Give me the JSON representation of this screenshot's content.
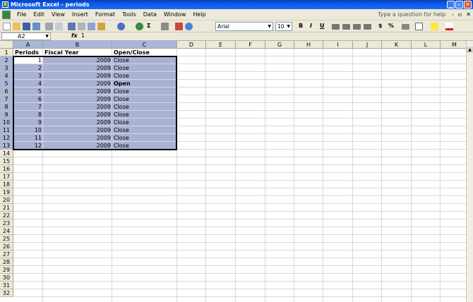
{
  "window": {
    "title": "Microsoft Excel - periods",
    "min": "_",
    "max": "▫",
    "close": "✕"
  },
  "menu": {
    "items": [
      "File",
      "Edit",
      "View",
      "Insert",
      "Format",
      "Tools",
      "Data",
      "Window",
      "Help"
    ],
    "help_placeholder": "Type a question for help",
    "doc_min": "-",
    "doc_restore": "▫",
    "doc_close": "✕"
  },
  "toolbar": {
    "font": "Arial",
    "size": "10",
    "bold": "B",
    "italic": "I",
    "underline": "U",
    "currency": "$",
    "percent": "%",
    "sigma": "Σ"
  },
  "formula": {
    "namebox": "A2",
    "fx": "fx",
    "value": "1"
  },
  "grid": {
    "columns": [
      "A",
      "B",
      "C",
      "D",
      "E",
      "F",
      "G",
      "H",
      "I",
      "J",
      "K",
      "L",
      "M"
    ],
    "rows": [
      "1",
      "2",
      "3",
      "4",
      "5",
      "6",
      "7",
      "8",
      "9",
      "10",
      "11",
      "12",
      "13",
      "14",
      "15",
      "16",
      "17",
      "18",
      "19",
      "20",
      "21",
      "22",
      "23",
      "24",
      "25",
      "26",
      "27",
      "28",
      "29",
      "30",
      "31",
      "32"
    ]
  },
  "headers": {
    "a": "Periods",
    "b": "Fiscal Year",
    "c": "Open/Close"
  },
  "data": [
    {
      "period": "1",
      "year": "2009",
      "status": "Close"
    },
    {
      "period": "2",
      "year": "2009",
      "status": "Close"
    },
    {
      "period": "3",
      "year": "2009",
      "status": "Close"
    },
    {
      "period": "4",
      "year": "2009",
      "status": "Open"
    },
    {
      "period": "5",
      "year": "2009",
      "status": "Close"
    },
    {
      "period": "6",
      "year": "2009",
      "status": "Close"
    },
    {
      "period": "7",
      "year": "2009",
      "status": "Close"
    },
    {
      "period": "8",
      "year": "2009",
      "status": "Close"
    },
    {
      "period": "9",
      "year": "2009",
      "status": "Close"
    },
    {
      "period": "10",
      "year": "2009",
      "status": "Close"
    },
    {
      "period": "11",
      "year": "2009",
      "status": "Close"
    },
    {
      "period": "12",
      "year": "2009",
      "status": "Close"
    }
  ]
}
